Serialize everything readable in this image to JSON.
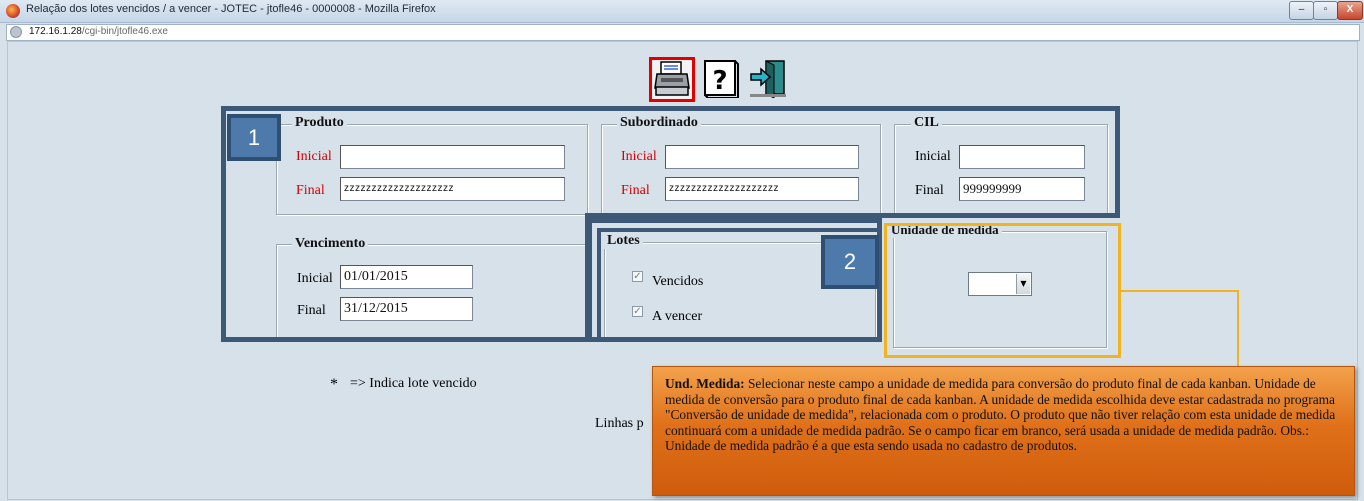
{
  "window": {
    "title": "Relação dos lotes vencidos / a vencer - JOTEC - jtofle46 - 0000008 - Mozilla Firefox",
    "url_host": "172.16.1.28",
    "url_path": "/cgi-bin/jtofle46.exe",
    "controls": [
      "–",
      "▫",
      "X"
    ]
  },
  "toolbar": {
    "icons": [
      "printer-icon",
      "help-icon",
      "exit-door-icon"
    ],
    "help_glyph": "?"
  },
  "produto": {
    "legend": "Produto",
    "inicial_label": "Inicial",
    "inicial_value": "",
    "final_label": "Final",
    "final_value": "zzzzzzzzzzzzzzzzzzzz"
  },
  "subordinado": {
    "legend": "Subordinado",
    "inicial_label": "Inicial",
    "inicial_value": "",
    "final_label": "Final",
    "final_value": "zzzzzzzzzzzzzzzzzzzz"
  },
  "cil": {
    "legend": "CIL",
    "inicial_label": "Inicial",
    "inicial_value": "",
    "final_label": "Final",
    "final_value": "999999999"
  },
  "vencimento": {
    "legend": "Vencimento",
    "inicial_label": "Inicial",
    "inicial_value": "01/01/2015",
    "final_label": "Final",
    "final_value": "31/12/2015"
  },
  "lotes": {
    "legend": "Lotes",
    "vencidos_label": "Vencidos",
    "vencidos_checked": true,
    "a_vencer_label": "A vencer",
    "a_vencer_checked": true,
    "check_glyph": "✓"
  },
  "unidade": {
    "legend": "Unidade de medida",
    "selected": "",
    "arrow": "▼"
  },
  "badges": {
    "one": "1",
    "two": "2"
  },
  "note": {
    "symbol": "*",
    "text": "=> Indica lote vencido"
  },
  "linhas_label": "Linhas p",
  "tooltip": {
    "title": "Und. Medida:",
    "text": " Selecionar neste campo a unidade de medida para conversão do produto final de cada kanban. Unidade de medida de conversão para o produto final de cada kanban. A unidade de medida escolhida deve estar cadastrada no programa \"Conversão de unidade de medida\", relacionada com o produto. O produto que não tiver relação com esta unidade de medida continuará com a unidade de medida padrão.  Se o campo ficar em branco, será usada a unidade de medida padrão. Obs.: Unidade de medida padrão é a que esta sendo usada no cadastro de produtos."
  },
  "colors": {
    "highlight_blue": "#3e5878",
    "badge_blue": "#4e79ab",
    "highlight_yellow": "#f2b320",
    "highlight_red": "#e00000",
    "tooltip_orange": "#e0711a",
    "label_red": "#d40000"
  }
}
